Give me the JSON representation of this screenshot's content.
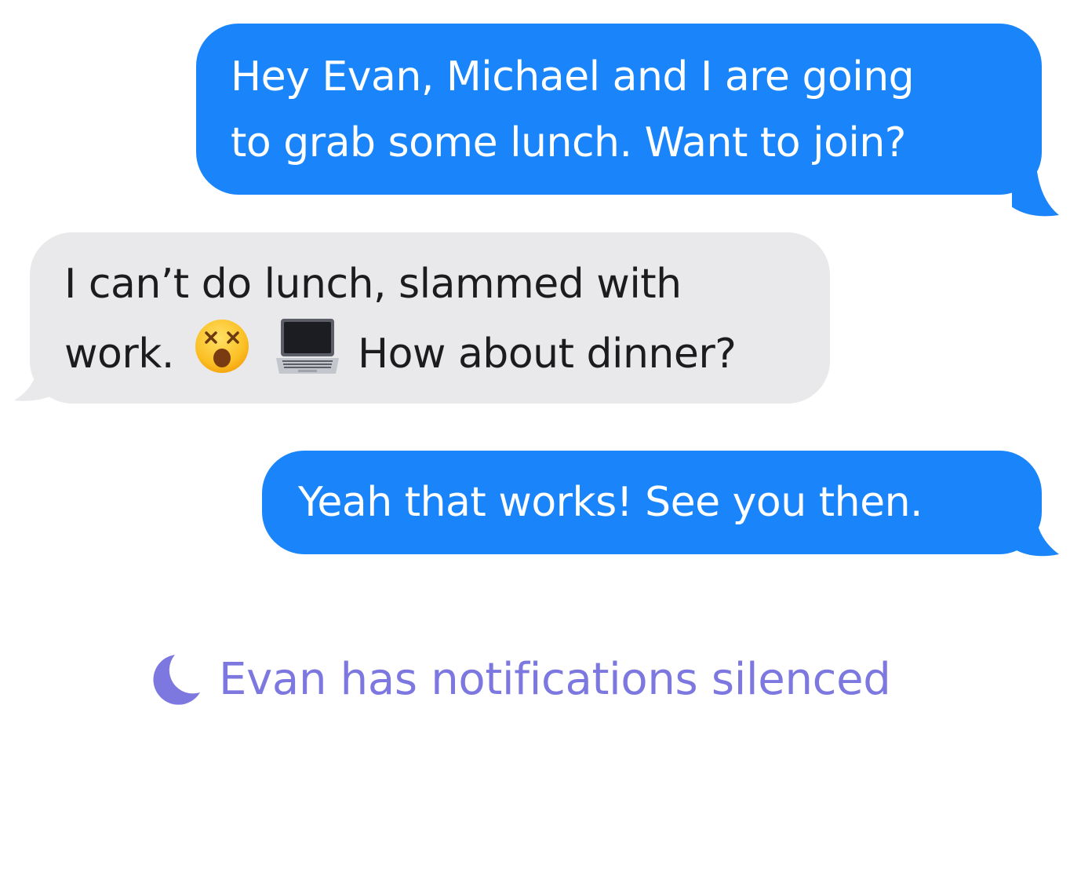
{
  "colors": {
    "sent_bubble": "#1a85fb",
    "received_bubble": "#e9e9eb",
    "status_text": "#7d78e0"
  },
  "messages": [
    {
      "direction": "sent",
      "lines": [
        "Hey Evan, Michael and I are going",
        "to grab some lunch. Want to join?"
      ]
    },
    {
      "direction": "received",
      "line1": "I can’t do lunch, slammed with",
      "line2_prefix": "work.",
      "emojis": [
        "dizzy-face-emoji",
        "laptop-emoji"
      ],
      "line2_suffix": "How about dinner?"
    },
    {
      "direction": "sent",
      "lines": [
        "Yeah that works! See you then."
      ]
    }
  ],
  "status": {
    "icon": "moon-icon",
    "text": "Evan has notifications silenced"
  }
}
